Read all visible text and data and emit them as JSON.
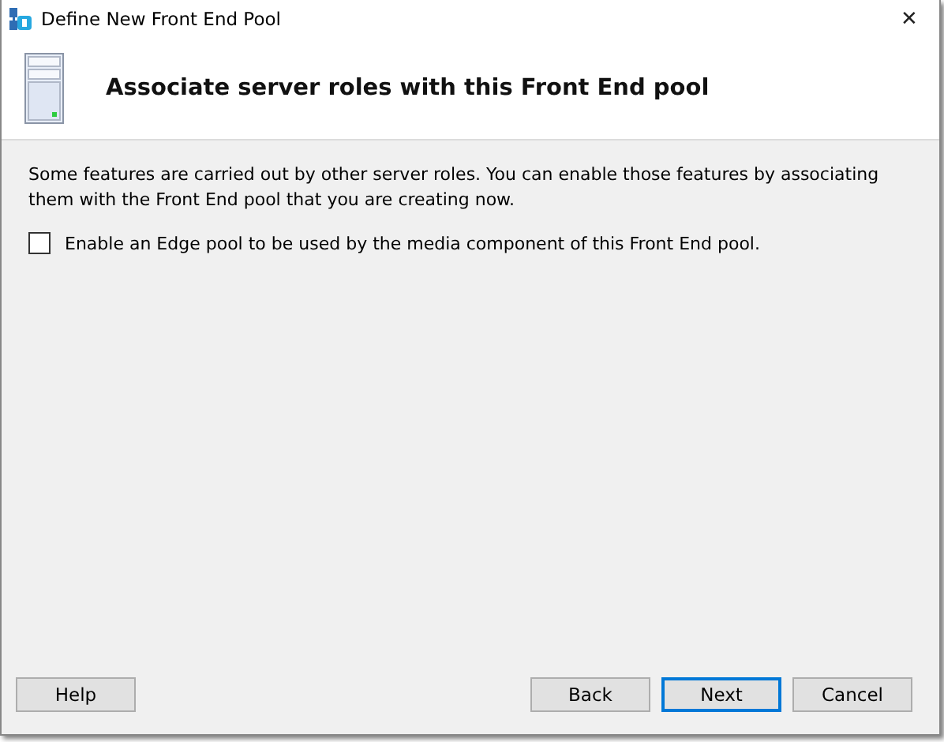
{
  "window": {
    "title": "Define New Front End Pool",
    "close": "✕"
  },
  "header": {
    "title": "Associate server roles with this Front End pool"
  },
  "description": "Some features are carried out by other server roles. You can enable those features by associating them with the Front End pool that you are creating now.",
  "options": [
    {
      "label": "Enable an Edge pool to be used by the media component of this Front End pool.",
      "checked": false
    }
  ],
  "buttons": [
    {
      "label": "Help",
      "focused": false
    },
    {
      "label": "Back",
      "focused": false
    },
    {
      "label": "Next",
      "focused": true
    },
    {
      "label": "Cancel",
      "focused": false
    }
  ]
}
